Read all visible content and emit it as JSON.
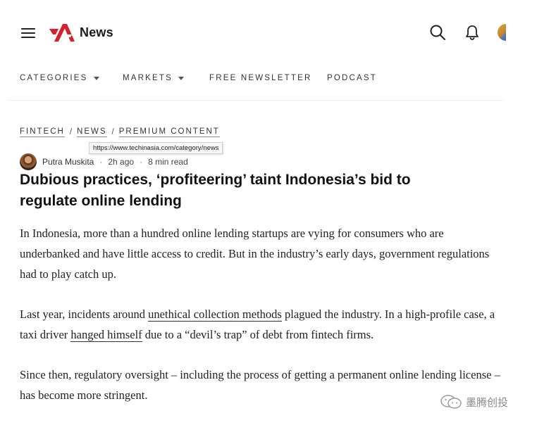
{
  "header": {
    "brand_name": "News",
    "logo_color": "#d3212d",
    "icons": [
      "menu-icon",
      "search-icon",
      "bell-icon"
    ]
  },
  "nav": {
    "items": [
      {
        "label": "CATEGORIES",
        "has_dropdown": true
      },
      {
        "label": "MARKETS",
        "has_dropdown": true
      },
      {
        "label": "FREE NEWSLETTER",
        "has_dropdown": false
      },
      {
        "label": "PODCAST",
        "has_dropdown": false
      }
    ]
  },
  "article": {
    "breadcrumb": [
      "FINTECH",
      "NEWS",
      "PREMIUM CONTENT"
    ],
    "breadcrumb_separator": "/",
    "tooltip": "https://www.techinasia.com/category/news",
    "byline": {
      "author": "Putra Muskita",
      "separator": "·",
      "time": "2h ago",
      "read_time": "8 min read"
    },
    "title": "Dubious practices, ‘profiteering’ taint Indonesia’s bid to regulate online lending",
    "paragraphs": {
      "p1": "In Indonesia, more than a hundred online lending startups are vying for consumers who are underbanked and have little access to credit. But in the industry’s early days, government regulations had to play catch up.",
      "p2": {
        "part1": "Last year, incidents around ",
        "link1": "unethical collection methods",
        "part2": " plagued the industry. In a high-profile case, a taxi driver ",
        "link2": "hanged himself",
        "part3": " due to a “devil’s trap” of debt from fintech firms."
      },
      "p3": "Since then, regulatory oversight – including the process of getting a permanent online lending license – has become more stringent."
    }
  },
  "watermark": {
    "text": "墨腾创投"
  }
}
